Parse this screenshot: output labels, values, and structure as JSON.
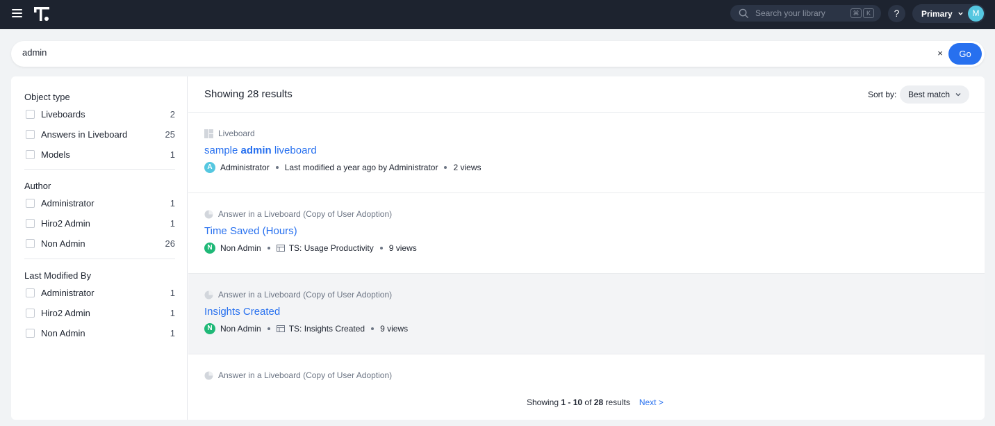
{
  "topbar": {
    "search_placeholder": "Search your library",
    "shortcut_keys": [
      "⌘",
      "K"
    ],
    "help_label": "?",
    "org_label": "Primary",
    "user_initial": "M"
  },
  "search": {
    "value": "admin",
    "clear_label": "×",
    "go_label": "Go"
  },
  "filters": [
    {
      "title": "Object type",
      "items": [
        {
          "label": "Liveboards",
          "count": "2"
        },
        {
          "label": "Answers in Liveboard",
          "count": "25"
        },
        {
          "label": "Models",
          "count": "1"
        }
      ]
    },
    {
      "title": "Author",
      "items": [
        {
          "label": "Administrator",
          "count": "1"
        },
        {
          "label": "Hiro2 Admin",
          "count": "1"
        },
        {
          "label": "Non Admin",
          "count": "26"
        }
      ]
    },
    {
      "title": "Last Modified By",
      "items": [
        {
          "label": "Administrator",
          "count": "1"
        },
        {
          "label": "Hiro2 Admin",
          "count": "1"
        },
        {
          "label": "Non Admin",
          "count": "1"
        }
      ]
    }
  ],
  "results_header": {
    "title": "Showing 28 results",
    "sort_label": "Sort by:",
    "sort_value": "Best match"
  },
  "results": [
    {
      "type": "Liveboard",
      "title_pre": "sample ",
      "title_match": "admin",
      "title_post": " liveboard",
      "author_initial": "A",
      "author": "Administrator",
      "modified": "Last modified a year ago by Administrator",
      "views": "2 views"
    },
    {
      "type": "Answer in a Liveboard (Copy of User Adoption)",
      "title": "Time Saved (Hours)",
      "author_initial": "N",
      "author": "Non Admin",
      "source": "TS: Usage Productivity",
      "views": "9 views"
    },
    {
      "type": "Answer in a Liveboard (Copy of User Adoption)",
      "title": "Insights Created",
      "author_initial": "N",
      "author": "Non Admin",
      "source": "TS: Insights Created",
      "views": "9 views"
    },
    {
      "type": "Answer in a Liveboard (Copy of User Adoption)"
    }
  ],
  "pagination": {
    "prefix": "Showing ",
    "start": "1",
    "sep": " - ",
    "end": "10",
    "of": " of ",
    "total": "28",
    "suffix": " results",
    "next_label": "Next >"
  },
  "colors": {
    "nav_bg": "#1d232f",
    "accent": "#2770ef",
    "avatar_admin": "#55c7e0",
    "avatar_nonadmin": "#1fb877"
  }
}
